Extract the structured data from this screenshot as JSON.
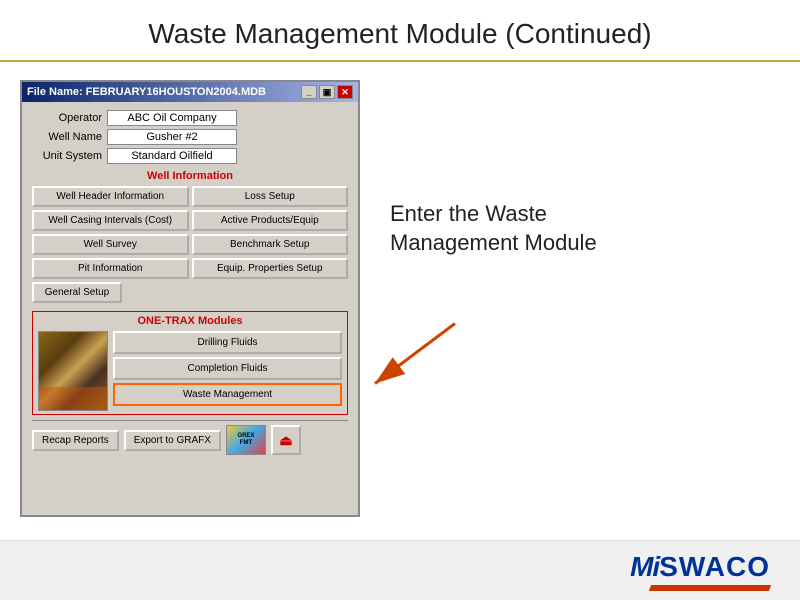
{
  "header": {
    "title": "Waste Management Module (Continued)"
  },
  "dialog": {
    "title": "File Name: FEBRUARY16HOUSTON2004.MDB",
    "titlebar_controls": [
      "minimize",
      "restore",
      "close"
    ],
    "fields": {
      "operator_label": "Operator",
      "operator_value": "ABC Oil Company",
      "wellname_label": "Well Name",
      "wellname_value": "Gusher #2",
      "unitsystem_label": "Unit System",
      "unitsystem_value": "Standard Oilfield"
    },
    "well_info_label": "Well Information",
    "buttons": [
      {
        "label": "Well Header Information",
        "col": 1
      },
      {
        "label": "Loss Setup",
        "col": 2
      },
      {
        "label": "Well Casing Intervals (Cost)",
        "col": 1
      },
      {
        "label": "Active Products/Equip",
        "col": 2
      },
      {
        "label": "Well Survey",
        "col": 1
      },
      {
        "label": "Benchmark Setup",
        "col": 2
      },
      {
        "label": "Pit Information",
        "col": 1
      },
      {
        "label": "Equip. Properties Setup",
        "col": 2
      }
    ],
    "general_setup_btn": "General Setup",
    "onetrax_label": "ONE-TRAX Modules",
    "onetrax_buttons": [
      {
        "label": "Drilling Fluids",
        "highlighted": false
      },
      {
        "label": "Completion Fluids",
        "highlighted": false
      },
      {
        "label": "Waste Management",
        "highlighted": true
      }
    ],
    "bottom_buttons": {
      "recap_reports": "Recap Reports",
      "export_grafx": "Export to GRAFX"
    }
  },
  "annotation": {
    "text": "Enter the Waste\nManagement Module"
  },
  "footer": {
    "logo_mi": "Mi",
    "logo_swaco": " SWACO"
  }
}
